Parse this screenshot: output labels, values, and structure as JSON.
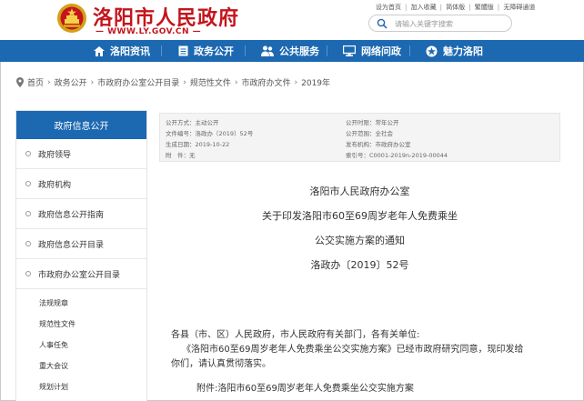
{
  "header": {
    "site_title": "洛阳市人民政府",
    "site_url": "— WWW.LY.GOV.CN —",
    "top_links": [
      "设为首页",
      "加入收藏",
      "简体版",
      "繁體版",
      "无障碍通道"
    ],
    "search_placeholder": "请输入关键字搜索"
  },
  "nav": {
    "items": [
      {
        "label": "洛阳资讯",
        "icon": "home-icon"
      },
      {
        "label": "政务公开",
        "icon": "document-icon"
      },
      {
        "label": "公共服务",
        "icon": "people-icon"
      },
      {
        "label": "网络问政",
        "icon": "monitor-icon"
      },
      {
        "label": "魅力洛阳",
        "icon": "star-icon"
      }
    ]
  },
  "breadcrumb": [
    "首页",
    "政务公开",
    "市政府办公室公开目录",
    "规范性文件",
    "市政府办文件",
    "2019年"
  ],
  "sidebar": {
    "title": "政府信息公开",
    "items": [
      "政府领导",
      "政府机构",
      "政府信息公开指南",
      "政府信息公开目录",
      "市政府办公室公开目录"
    ],
    "sub_items": [
      "法规规章",
      "规范性文件",
      "人事任免",
      "重大会议",
      "规划计划"
    ]
  },
  "meta": {
    "left": [
      {
        "label": "公开方式：",
        "value": "主动公开"
      },
      {
        "label": "文件编号：",
        "value": "洛政办〔2019〕52号"
      },
      {
        "label": "生成日期：",
        "value": "2019-10-22"
      },
      {
        "label": "附　件：",
        "value": "无"
      }
    ],
    "right": [
      {
        "label": "公开时限：",
        "value": "常年公开"
      },
      {
        "label": "公开范围：",
        "value": "全社会"
      },
      {
        "label": "发布机构：",
        "value": "市政府办公室"
      },
      {
        "label": "索引号：",
        "value": "C0001-2019n-2019-00044"
      }
    ]
  },
  "document": {
    "issuer": "洛阳市人民政府办公室",
    "title_line1": "关于印发洛阳市60至69周岁老年人免费乘坐",
    "title_line2": "公交实施方案的通知",
    "doc_number": "洛政办〔2019〕52号",
    "salutation": "各县（市、区）人民政府，市人民政府有关部门，各有关单位:",
    "para_line1": "《洛阳市60至69周岁老年人免费乘坐公交实施方案》已经市政府研究同意，现印发给",
    "para_line2": "你们，请认真贯彻落实。",
    "attachment": "附件:洛阳市60至69周岁老年人免费乘坐公交实施方案"
  },
  "colors": {
    "brand_red": "#c4151c",
    "nav_blue": "#1c68b1"
  }
}
